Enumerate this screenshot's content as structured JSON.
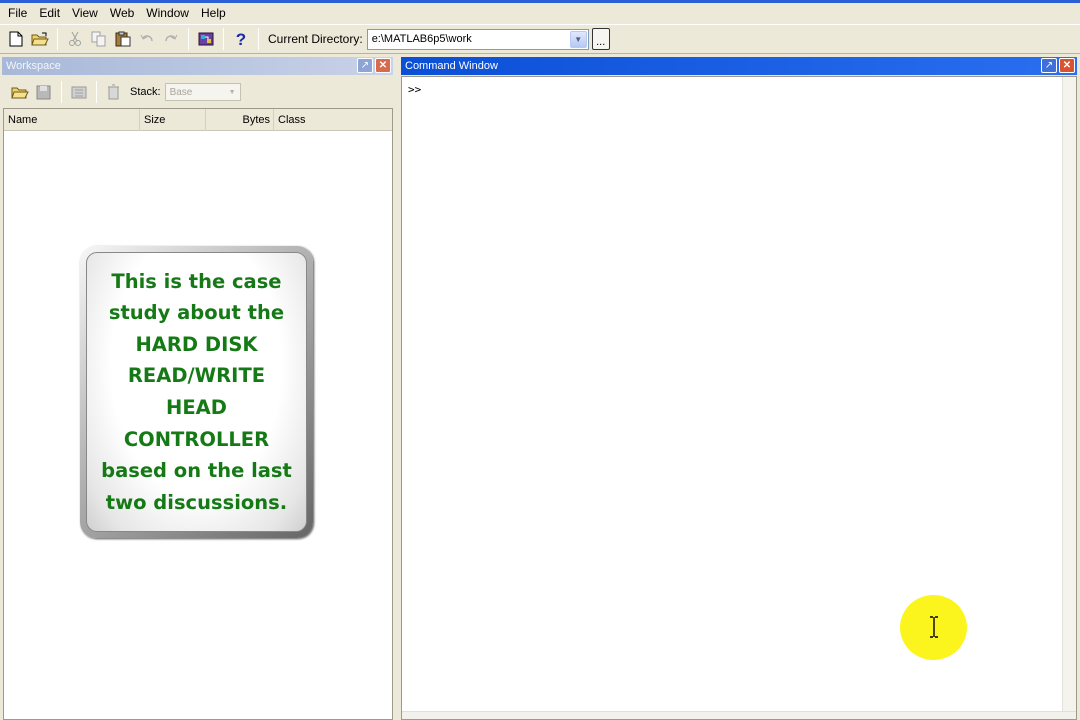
{
  "menu": {
    "items": [
      "File",
      "Edit",
      "View",
      "Web",
      "Window",
      "Help"
    ]
  },
  "toolbar": {
    "icons": [
      "new-file-icon",
      "open-folder-icon",
      "cut-icon",
      "copy-icon",
      "paste-icon",
      "undo-icon",
      "redo-icon",
      "simulink-icon",
      "help-icon"
    ],
    "current_directory_label": "Current Directory:",
    "current_directory_value": "e:\\MATLAB6p5\\work",
    "browse_label": "..."
  },
  "workspace": {
    "title": "Workspace",
    "stack_label": "Stack:",
    "stack_value": "Base",
    "columns": [
      "Name",
      "Size",
      "Bytes",
      "Class"
    ]
  },
  "command_window": {
    "title": "Command Window",
    "prompt": ">>"
  },
  "overlay_note": {
    "text": "This is the case\nstudy about the\nHARD DISK\nREAD/WRITE\nHEAD\nCONTROLLER\nbased on the last\ntwo discussions."
  },
  "colors": {
    "note_text": "#157a16",
    "cursor_highlight": "#fbf51d",
    "active_title": "#0a4fd6",
    "inactive_title": "#a8b8d8"
  }
}
